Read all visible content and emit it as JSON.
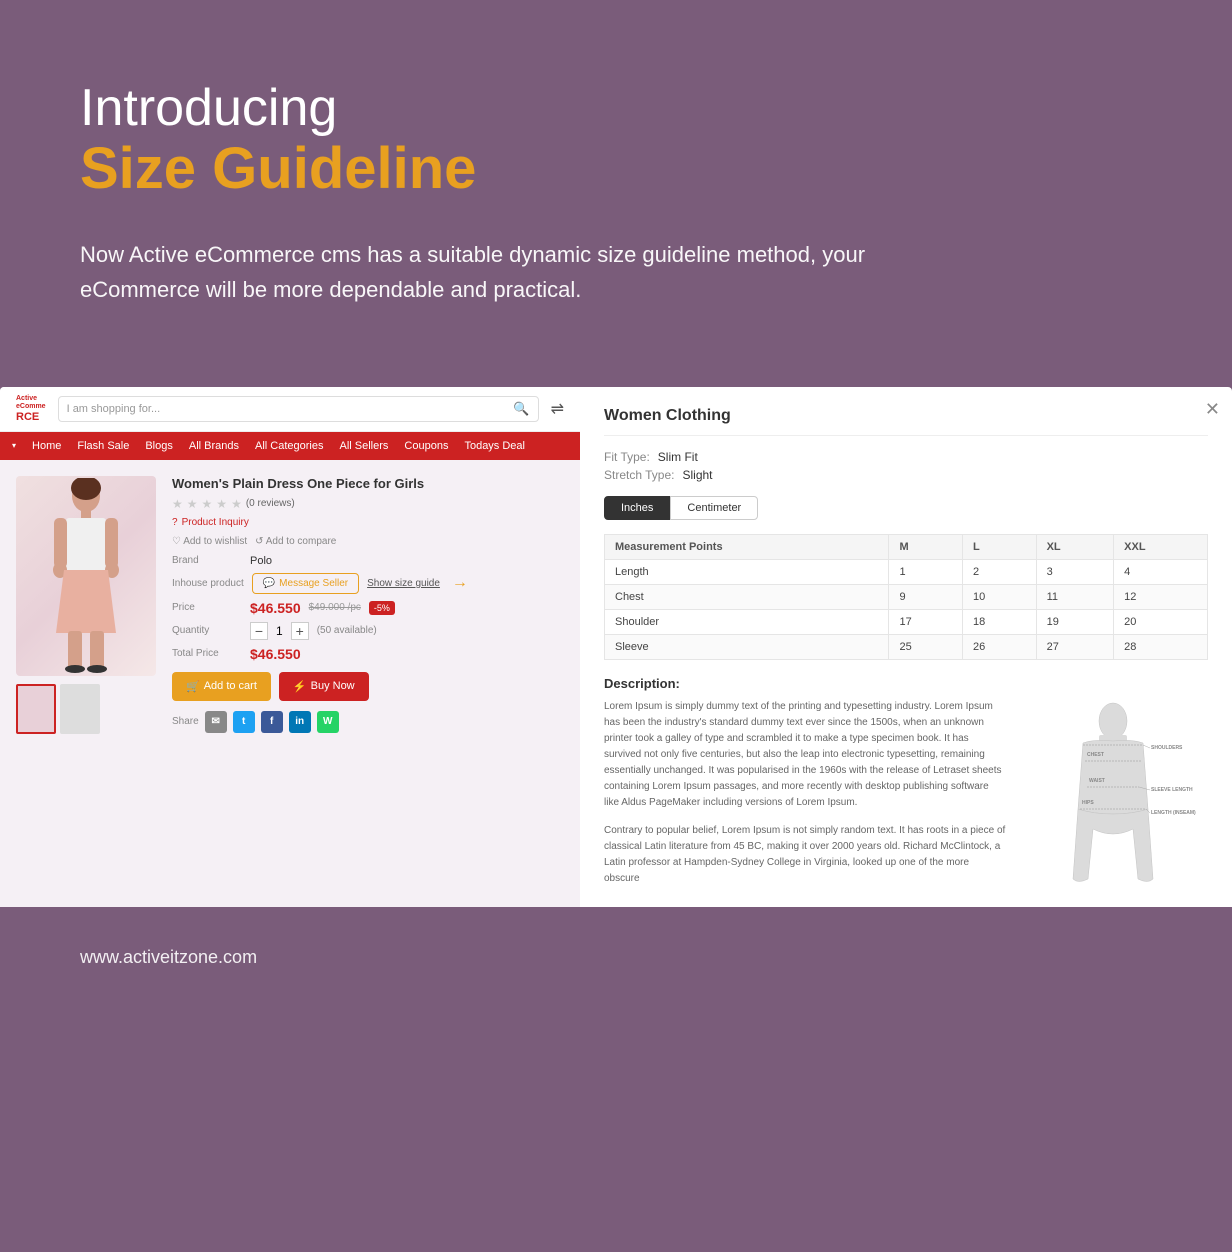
{
  "hero": {
    "intro_line": "Introducing",
    "title_line": "Size Guideline",
    "description": "Now Active eCommerce cms has a suitable dynamic size guideline method, your eCommerce will be more dependable and practical."
  },
  "nav": {
    "logo_line1": "Active",
    "logo_line2": "eComme",
    "logo_line3": "RCE",
    "search_placeholder": "I am shopping for...",
    "menu_items": [
      "Home",
      "Flash Sale",
      "Blogs",
      "All Brands",
      "All Categories",
      "All Sellers",
      "Coupons",
      "Todays Deal"
    ]
  },
  "product": {
    "title": "Women's Plain Dress One Piece for Girls",
    "reviews": "(0 reviews)",
    "inquiry_label": "Product Inquiry",
    "wishlist_label": "Add to wishlist",
    "compare_label": "Add to compare",
    "brand_label": "Brand",
    "brand_value": "Polo",
    "inhouse_label": "Inhouse product",
    "message_seller": "Message Seller",
    "show_size_guide": "Show size guide",
    "price_label": "Price",
    "price_current": "$46.550",
    "price_original": "$49.000 /pc",
    "price_discount": "-5%",
    "quantity_label": "Quantity",
    "quantity_value": "1",
    "quantity_available": "(50 available)",
    "total_price_label": "Total Price",
    "total_price": "$46.550",
    "add_to_cart": "Add to cart",
    "buy_now": "Buy Now",
    "share_label": "Share"
  },
  "size_guide_modal": {
    "title": "Women Clothing",
    "fit_type_label": "Fit Type:",
    "fit_type_value": "Slim Fit",
    "stretch_type_label": "Stretch Type:",
    "stretch_type_value": "Slight",
    "unit_inches": "Inches",
    "unit_centimeter": "Centimeter",
    "table_headers": [
      "Measurement Points",
      "M",
      "L",
      "XL",
      "XXL"
    ],
    "table_rows": [
      {
        "point": "Length",
        "m": "1",
        "l": "2",
        "xl": "3",
        "xxl": "4"
      },
      {
        "point": "Chest",
        "m": "9",
        "l": "10",
        "xl": "11",
        "xxl": "12"
      },
      {
        "point": "Shoulder",
        "m": "17",
        "l": "18",
        "xl": "19",
        "xxl": "20"
      },
      {
        "point": "Sleeve",
        "m": "25",
        "l": "26",
        "xl": "27",
        "xxl": "28"
      }
    ],
    "description_title": "Description:",
    "description_text_1": "Lorem Ipsum is simply dummy text of the printing and typesetting industry. Lorem Ipsum has been the industry's standard dummy text ever since the 1500s, when an unknown printer took a galley of type and scrambled it to make a type specimen book. It has survived not only five centuries, but also the leap into electronic typesetting, remaining essentially unchanged. It was popularised in the 1960s with the release of Letraset sheets containing Lorem Ipsum passages, and more recently with desktop publishing software like Aldus PageMaker including versions of Lorem Ipsum.",
    "description_text_2": "Contrary to popular belief, Lorem Ipsum is not simply random text. It has roots in a piece of classical Latin literature from 45 BC, making it over 2000 years old. Richard McClintock, a Latin professor at Hampden-Sydney College in Virginia, looked up one of the more obscure",
    "body_labels": [
      "CHEST",
      "WAIST",
      "HIPS",
      "SHOULDERS",
      "SLEEVE LENGTH",
      "LENGTH (INSEAM)"
    ]
  },
  "footer": {
    "url": "www.activeitzone.com"
  },
  "colors": {
    "bg_purple": "#7a5c7a",
    "accent_orange": "#e8a020",
    "accent_red": "#cc2222",
    "white": "#ffffff"
  }
}
